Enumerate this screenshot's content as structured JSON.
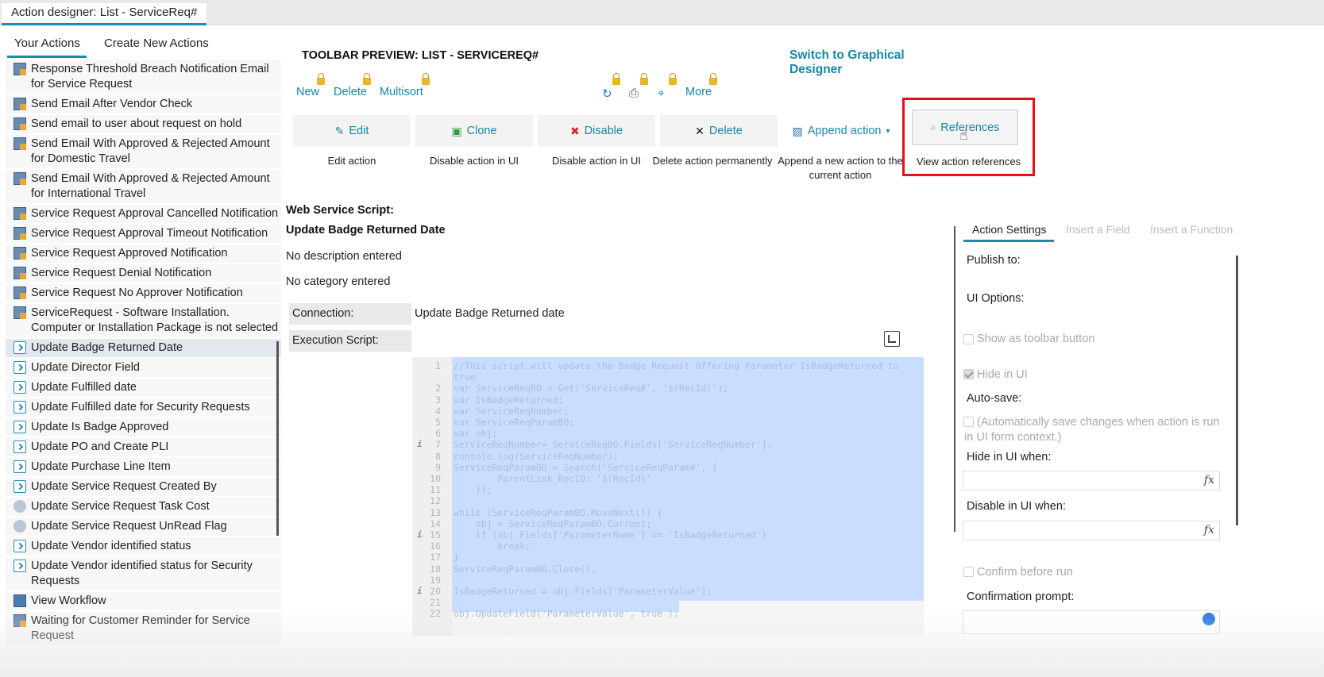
{
  "window": {
    "tab_title": "Action designer: List - ServiceReq#"
  },
  "left": {
    "tabs": [
      "Your Actions",
      "Create New Actions"
    ],
    "items": [
      {
        "label": "Response Threshold Breach Notification Email for Service Request",
        "icon": "email-action-icon"
      },
      {
        "label": "Send Email After Vendor Check",
        "icon": "email-action-icon"
      },
      {
        "label": "Send email to user about request on hold",
        "icon": "email-action-icon"
      },
      {
        "label": "Send Email With Approved & Rejected Amount for Domestic Travel",
        "icon": "email-action-icon"
      },
      {
        "label": "Send Email With Approved & Rejected Amount for International Travel",
        "icon": "email-action-icon"
      },
      {
        "label": "Service Request Approval Cancelled Notification",
        "icon": "email-action-icon"
      },
      {
        "label": "Service Request Approval Timeout Notification",
        "icon": "email-action-icon"
      },
      {
        "label": "Service Request Approved Notification",
        "icon": "email-action-icon"
      },
      {
        "label": "Service Request Denial Notification",
        "icon": "email-action-icon"
      },
      {
        "label": "Service Request No Approver Notification",
        "icon": "email-action-icon"
      },
      {
        "label": "ServiceRequest - Software Installation. Computer or Installation Package is not selected",
        "icon": "email-action-icon"
      },
      {
        "label": "Update Badge Returned Date",
        "icon": "script-action-icon",
        "selected": true
      },
      {
        "label": "Update Director Field",
        "icon": "script-action-icon"
      },
      {
        "label": "Update Fulfilled date",
        "icon": "script-action-icon"
      },
      {
        "label": "Update Fulfilled date for Security Requests",
        "icon": "script-action-icon"
      },
      {
        "label": "Update Is Badge Approved",
        "icon": "script-action-icon"
      },
      {
        "label": "Update PO and Create PLI",
        "icon": "script-action-icon"
      },
      {
        "label": "Update Purchase Line Item",
        "icon": "script-action-icon"
      },
      {
        "label": "Update Service Request Created By",
        "icon": "script-action-icon"
      },
      {
        "label": "Update Service Request Task Cost",
        "icon": "calc-action-icon"
      },
      {
        "label": "Update Service Request UnRead Flag",
        "icon": "calc-action-icon"
      },
      {
        "label": "Update Vendor identified status",
        "icon": "script-action-icon"
      },
      {
        "label": "Update Vendor identified status for Security Requests",
        "icon": "script-action-icon"
      },
      {
        "label": "View Workflow",
        "icon": "workflow-action-icon"
      },
      {
        "label": "Waiting for Customer Reminder for Service Request",
        "icon": "email-action-icon"
      }
    ]
  },
  "toolbar_preview": {
    "title": "TOOLBAR PREVIEW: LIST - SERVICEREQ#",
    "switch_link": "Switch to Graphical Designer",
    "links": [
      "New",
      "Delete",
      "Multisort",
      "More"
    ],
    "icons": [
      "refresh-icon",
      "print-icon",
      "pin-icon"
    ]
  },
  "actions": [
    {
      "label": "Edit",
      "desc": "Edit action",
      "icon": "pencil-icon"
    },
    {
      "label": "Clone",
      "desc": "Disable action in UI",
      "icon": "clone-icon"
    },
    {
      "label": "Disable",
      "desc": "Disable action in UI",
      "icon": "disable-icon"
    },
    {
      "label": "Delete",
      "desc": "Delete action permanently",
      "icon": "delete-x-icon"
    },
    {
      "label": "Append action",
      "desc": "Append a new action to the current action",
      "icon": "append-icon"
    },
    {
      "label": "References",
      "desc": "View action references",
      "icon": "search-icon"
    }
  ],
  "detail": {
    "type_title": "Web Service Script:",
    "name": "Update Badge Returned Date",
    "description": "No description entered",
    "category": "No category entered",
    "connection_label": "Connection:",
    "connection_value": "Update Badge Returned date",
    "exec_label": "Execution Script:"
  },
  "code_lines": [
    {
      "n": "1",
      "text": "//This script will update the Badge Request Offering Parameter IsBadgeReturned to"
    },
    {
      "n": "",
      "text": "true"
    },
    {
      "n": "2",
      "text": "var ServiceReqBO = Get('ServiceReq#', '$(RecId)');"
    },
    {
      "n": "3",
      "text": "var IsBadgeReturned;"
    },
    {
      "n": "4",
      "text": "var ServiceReqNumber;"
    },
    {
      "n": "5",
      "text": "var ServiceReqParamBO;"
    },
    {
      "n": "6",
      "text": "var obj;"
    },
    {
      "n": "7",
      "text": "ServiceReqNumber= ServiceReqBO.Fields['ServiceReqNumber'];",
      "info": true
    },
    {
      "n": "8",
      "text": "console.log(ServiceReqNumber);"
    },
    {
      "n": "9",
      "text": "ServiceReqParamBO = Search('ServiceReqParam#', {"
    },
    {
      "n": "10",
      "text": "        ParentLink_RecID: '$(RecId)'"
    },
    {
      "n": "11",
      "text": "    });"
    },
    {
      "n": "12",
      "text": ""
    },
    {
      "n": "13",
      "text": "while (ServiceReqParamBO.MoveNext()) {"
    },
    {
      "n": "14",
      "text": "    obj = ServiceReqParamBO.Current;"
    },
    {
      "n": "15",
      "text": "    if (obj.Fields['ParameterName'] == 'IsBadgeReturned')",
      "info": true
    },
    {
      "n": "16",
      "text": "        break;"
    },
    {
      "n": "17",
      "text": "}"
    },
    {
      "n": "18",
      "text": "ServiceReqParamBO.Close();"
    },
    {
      "n": "19",
      "text": ""
    },
    {
      "n": "20",
      "text": "IsBadgeReturned = obj.Fields['ParameterValue'];",
      "info": true
    },
    {
      "n": "21",
      "text": ""
    },
    {
      "n": "22",
      "text": "obj.UpdateField('ParameterValue', true );"
    }
  ],
  "settings": {
    "tabs": [
      "Action Settings",
      "Insert a Field",
      "Insert a Function"
    ],
    "publish_to": "Publish to:",
    "ui_options": "UI Options:",
    "show_toolbar": "Show as toolbar button",
    "hide_in_ui": "Hide in UI",
    "autosave": "Auto-save:",
    "autosave_desc": "(Automatically save changes when action is run in UI form context.)",
    "hide_when": "Hide in UI when:",
    "disable_when": "Disable in UI when:",
    "confirm": "Confirm before run",
    "confirm_prompt": "Confirmation prompt:",
    "fx": "fx"
  }
}
